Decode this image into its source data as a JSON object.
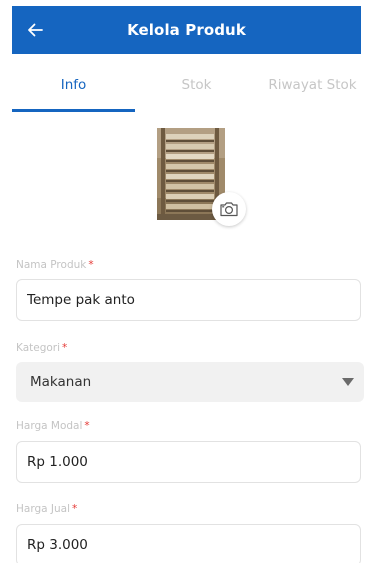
{
  "appbar": {
    "title": "Kelola Produk",
    "back_icon": "arrow-left-icon",
    "color": "#1565c0"
  },
  "tabs": [
    {
      "label": "Info",
      "active": true
    },
    {
      "label": "Stok",
      "active": false
    },
    {
      "label": "Riwayat Stok",
      "active": false
    }
  ],
  "photo": {
    "camera_icon": "camera-icon"
  },
  "form": {
    "nama_produk": {
      "label": "Nama Produk",
      "required_mark": "*",
      "value": "Tempe pak anto"
    },
    "kategori": {
      "label": "Kategori",
      "required_mark": "*",
      "value": "Makanan",
      "caret_icon": "caret-down-icon"
    },
    "harga_modal": {
      "label": "Harga Modal",
      "required_mark": "*",
      "value": "Rp 1.000"
    },
    "harga_jual": {
      "label": "Harga Jual",
      "required_mark": "*",
      "value": "Rp 3.000"
    }
  }
}
